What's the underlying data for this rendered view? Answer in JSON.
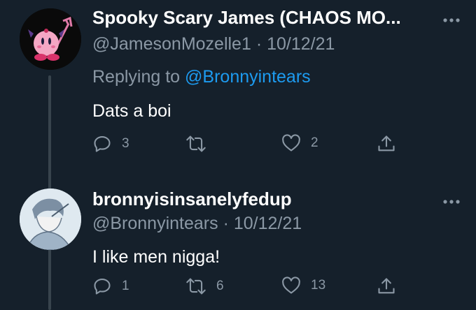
{
  "tweets": [
    {
      "display_name": "Spooky Scary James (CHAOS MO...",
      "handle": "@JamesonMozelle1",
      "date": "10/12/21",
      "reply_prefix": "Replying to ",
      "reply_mention": "@Bronnyintears",
      "text": "Dats a boi",
      "reply_count": "3",
      "retweet_count": "",
      "like_count": "2"
    },
    {
      "display_name": "bronnyisinsanelyfedup",
      "handle": "@Bronnyintears",
      "date": "10/12/21",
      "text": "I like men nigga!",
      "reply_count": "1",
      "retweet_count": "6",
      "like_count": "13"
    }
  ],
  "separator": "·",
  "colors": {
    "background": "#15202b",
    "secondary_text": "#8b98a5",
    "link": "#1d9bf0",
    "thread_line": "#38444d"
  },
  "icons": [
    "more-icon",
    "reply-icon",
    "retweet-icon",
    "like-icon",
    "share-icon"
  ]
}
